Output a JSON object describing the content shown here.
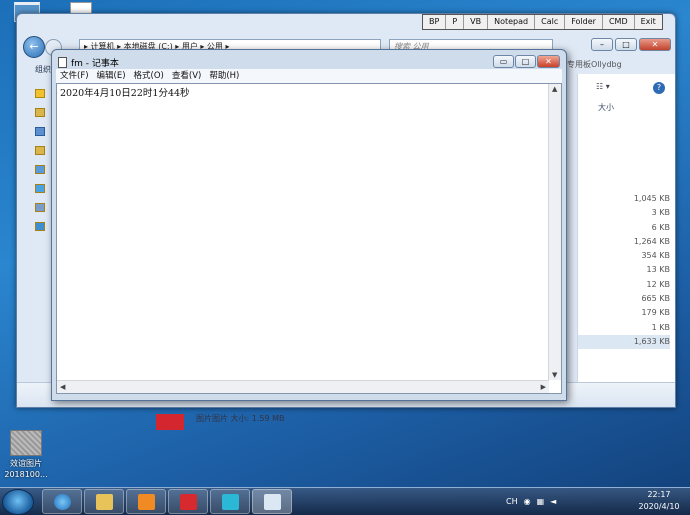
{
  "desktop": {
    "photo_icon_label": "效谊图片\n2018100..."
  },
  "toolbar": {
    "buttons": [
      "BP",
      "P",
      "VB",
      "Notepad",
      "Calc",
      "Folder",
      "CMD",
      "Exit"
    ]
  },
  "explorer": {
    "address": "▸ 计算机 ▸ 本地磁盘 (C:) ▸ 用户 ▸ 公用 ▸",
    "search_placeholder": "搜索 公用",
    "organize_label": "组织",
    "library_name": "专用板Ollydbg",
    "size_header": "大小",
    "sizes": [
      "1,045 KB",
      "3 KB",
      "6 KB",
      "1,264 KB",
      "354 KB",
      "13 KB",
      "12 KB",
      "665 KB",
      "179 KB",
      "1 KB",
      "1,633 KB"
    ],
    "detail_text": "图片图片      大小: 1.59 MB"
  },
  "notepad": {
    "title": "fm - 记事本",
    "menu": [
      "文件(F)",
      "编辑(E)",
      "格式(O)",
      "查看(V)",
      "帮助(H)"
    ],
    "content": "2020年4月10日22时1分44秒"
  },
  "taskbar": {
    "tray_lang": "CH",
    "time": "22:17",
    "date": "2020/4/10"
  }
}
